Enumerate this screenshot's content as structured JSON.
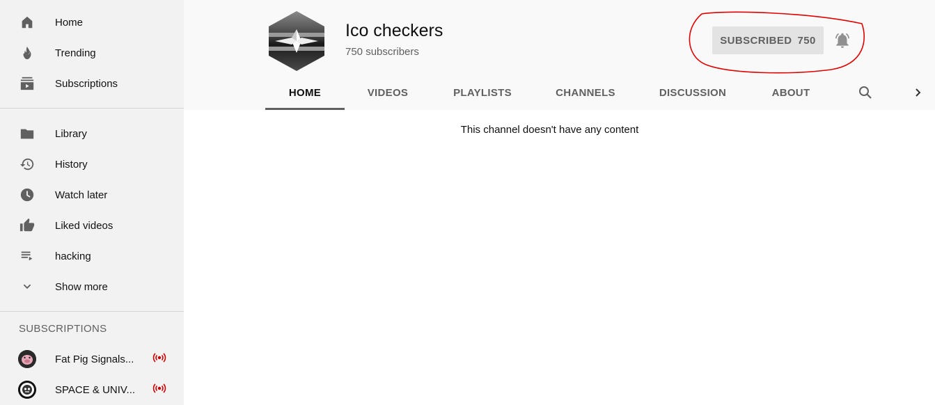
{
  "sidebar": {
    "primary": [
      {
        "label": "Home",
        "icon": "home-icon"
      },
      {
        "label": "Trending",
        "icon": "fire-icon"
      },
      {
        "label": "Subscriptions",
        "icon": "subscriptions-icon"
      }
    ],
    "library": [
      {
        "label": "Library",
        "icon": "folder-icon"
      },
      {
        "label": "History",
        "icon": "history-icon"
      },
      {
        "label": "Watch later",
        "icon": "clock-icon"
      },
      {
        "label": "Liked videos",
        "icon": "thumbs-up-icon"
      },
      {
        "label": "hacking",
        "icon": "playlist-icon"
      },
      {
        "label": "Show more",
        "icon": "chevron-down-icon"
      }
    ],
    "subscriptions_heading": "SUBSCRIPTIONS",
    "subscriptions": [
      {
        "label": "Fat Pig Signals...",
        "live": true
      },
      {
        "label": "SPACE & UNIV...",
        "live": true
      }
    ]
  },
  "channel": {
    "name": "Ico checkers",
    "subscribers": "750 subscribers",
    "subscribe_label": "SUBSCRIBED",
    "subscribe_count": "750"
  },
  "tabs": [
    {
      "label": "HOME",
      "active": true
    },
    {
      "label": "VIDEOS",
      "active": false
    },
    {
      "label": "PLAYLISTS",
      "active": false
    },
    {
      "label": "CHANNELS",
      "active": false
    },
    {
      "label": "DISCUSSION",
      "active": false
    },
    {
      "label": "ABOUT",
      "active": false
    }
  ],
  "content": {
    "empty_message": "This channel doesn't have any content"
  },
  "colors": {
    "sidebar_bg": "#f2f2f2",
    "header_bg": "#f9f9f9",
    "live_red": "#cc0000",
    "annotation_red": "#e00000"
  }
}
